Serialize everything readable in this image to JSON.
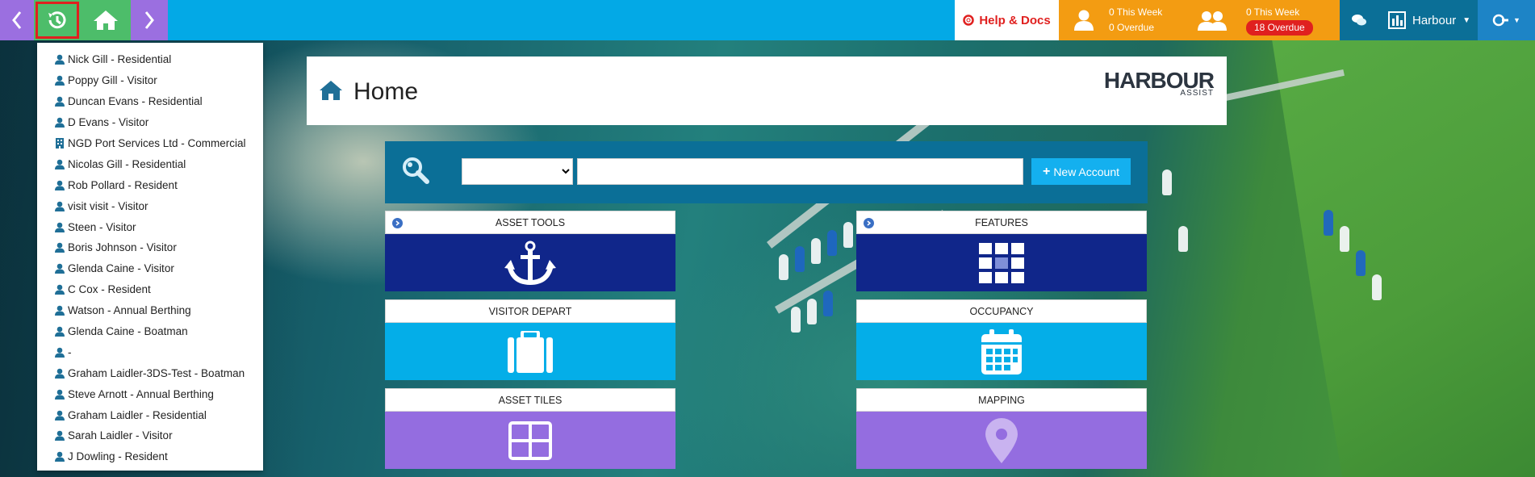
{
  "topbar": {
    "help_label": "Help & Docs",
    "my_tasks": {
      "this_week": "0 This Week",
      "overdue": "0 Overdue"
    },
    "team_tasks": {
      "this_week": "0 This Week",
      "overdue": "18 Overdue"
    },
    "org_name": "Harbour",
    "colors": {
      "bar": "#03a9e6",
      "back": "#9b6fe0",
      "history": "#4dbd6a",
      "tasks": "#f39c12",
      "overdue_pill": "#e0201f"
    }
  },
  "history": {
    "items": [
      {
        "label": "Nick Gill - Residential",
        "icon": "person-icon"
      },
      {
        "label": "Poppy Gill - Visitor",
        "icon": "person-icon"
      },
      {
        "label": "Duncan Evans - Residential",
        "icon": "person-icon"
      },
      {
        "label": "D Evans - Visitor",
        "icon": "person-icon"
      },
      {
        "label": "NGD Port Services Ltd - Commercial",
        "icon": "building-icon"
      },
      {
        "label": "Nicolas Gill - Residential",
        "icon": "person-icon"
      },
      {
        "label": "Rob Pollard - Resident",
        "icon": "person-icon"
      },
      {
        "label": "visit visit - Visitor",
        "icon": "person-icon"
      },
      {
        "label": "Steen - Visitor",
        "icon": "person-icon"
      },
      {
        "label": "Boris Johnson - Visitor",
        "icon": "person-icon"
      },
      {
        "label": "Glenda Caine - Visitor",
        "icon": "person-icon"
      },
      {
        "label": "C Cox - Resident",
        "icon": "person-icon"
      },
      {
        "label": "Watson - Annual Berthing",
        "icon": "person-icon"
      },
      {
        "label": "Glenda Caine - Boatman",
        "icon": "person-icon"
      },
      {
        "label": "-",
        "icon": "person-icon"
      },
      {
        "label": "Graham Laidler-3DS-Test - Boatman",
        "icon": "person-icon"
      },
      {
        "label": "Steve Arnott - Annual Berthing",
        "icon": "person-icon"
      },
      {
        "label": "Graham Laidler - Residential",
        "icon": "person-icon"
      },
      {
        "label": "Sarah Laidler - Visitor",
        "icon": "person-icon"
      },
      {
        "label": "J Dowling - Resident",
        "icon": "person-icon"
      }
    ]
  },
  "header": {
    "title": "Home",
    "logo_text": "HARBOUR",
    "logo_sub": "ASSIST"
  },
  "search": {
    "select_value": "",
    "input_value": "",
    "new_account_label": "New Account"
  },
  "tiles": [
    {
      "caption": "ASSET TOOLS",
      "icon": "anchor-icon",
      "color": "#10268a"
    },
    {
      "caption": "FEATURES",
      "icon": "grid-icon",
      "color": "#10268a"
    },
    {
      "caption": "VISITOR DEPART",
      "icon": "suitcase-icon",
      "color": "#04aee8"
    },
    {
      "caption": "OCCUPANCY",
      "icon": "calendar-icon",
      "color": "#04aee8"
    },
    {
      "caption": "ASSET TILES",
      "icon": "tiles-icon",
      "color": "#946de0"
    },
    {
      "caption": "MAPPING",
      "icon": "map-pin-icon",
      "color": "#946de0"
    }
  ]
}
